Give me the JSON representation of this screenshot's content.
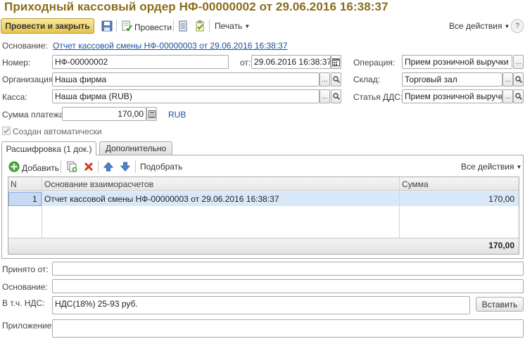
{
  "title": "Приходный кассовый ордер НФ-00000002 от 29.06.2016 16:38:37",
  "toolbar": {
    "post_and_close": "Провести и закрыть",
    "post": "Провести",
    "print": "Печать",
    "all_actions": "Все действия"
  },
  "basis_doc": {
    "label": "Основание:",
    "link": "Отчет кассовой смены НФ-00000003 от 29.06.2016 16:38:37"
  },
  "number": {
    "label": "Номер:",
    "value": "НФ-00000002"
  },
  "date": {
    "label": "от:",
    "value": "29.06.2016 16:38:37"
  },
  "operation": {
    "label": "Операция:",
    "value": "Прием розничной выручки"
  },
  "organization": {
    "label": "Организация:",
    "value": "Наша фирма"
  },
  "warehouse": {
    "label": "Склад:",
    "value": "Торговый зал"
  },
  "cashbox": {
    "label": "Касса:",
    "value": "Наша фирма (RUB)"
  },
  "cashflow_item": {
    "label": "Статья ДДС:",
    "value": "Прием розничной выручки"
  },
  "amount": {
    "label": "Сумма платежа:",
    "value": "170,00",
    "currency": "RUB"
  },
  "auto_created": {
    "label": "Создан автоматически",
    "checked": true
  },
  "tabs": [
    {
      "label": "Расшифровка (1 док.)",
      "active": true
    },
    {
      "label": "Дополнительно",
      "active": false
    }
  ],
  "table_toolbar": {
    "add": "Добавить",
    "pick": "Подобрать",
    "all_actions": "Все действия"
  },
  "table": {
    "columns": [
      "N",
      "Основание взаиморасчетов",
      "Сумма"
    ],
    "rows": [
      {
        "n": "1",
        "basis": "Отчет кассовой смены НФ-00000003 от 29.06.2016 16:38:37",
        "sum": "170,00"
      }
    ],
    "total": "170,00"
  },
  "received_from": {
    "label": "Принято от:",
    "value": ""
  },
  "reason": {
    "label": "Основание:",
    "value": ""
  },
  "vat": {
    "label": "В т.ч. НДС:",
    "value": "НДС(18%) 25-93 руб.",
    "insert_button": "Вставить"
  },
  "attachment": {
    "label": "Приложение:",
    "value": ""
  },
  "colors": {
    "title": "#8a6d1a",
    "link": "#1c4f9c",
    "primary_button": "#e4c24b",
    "selected_row": "#d9e8f9"
  }
}
